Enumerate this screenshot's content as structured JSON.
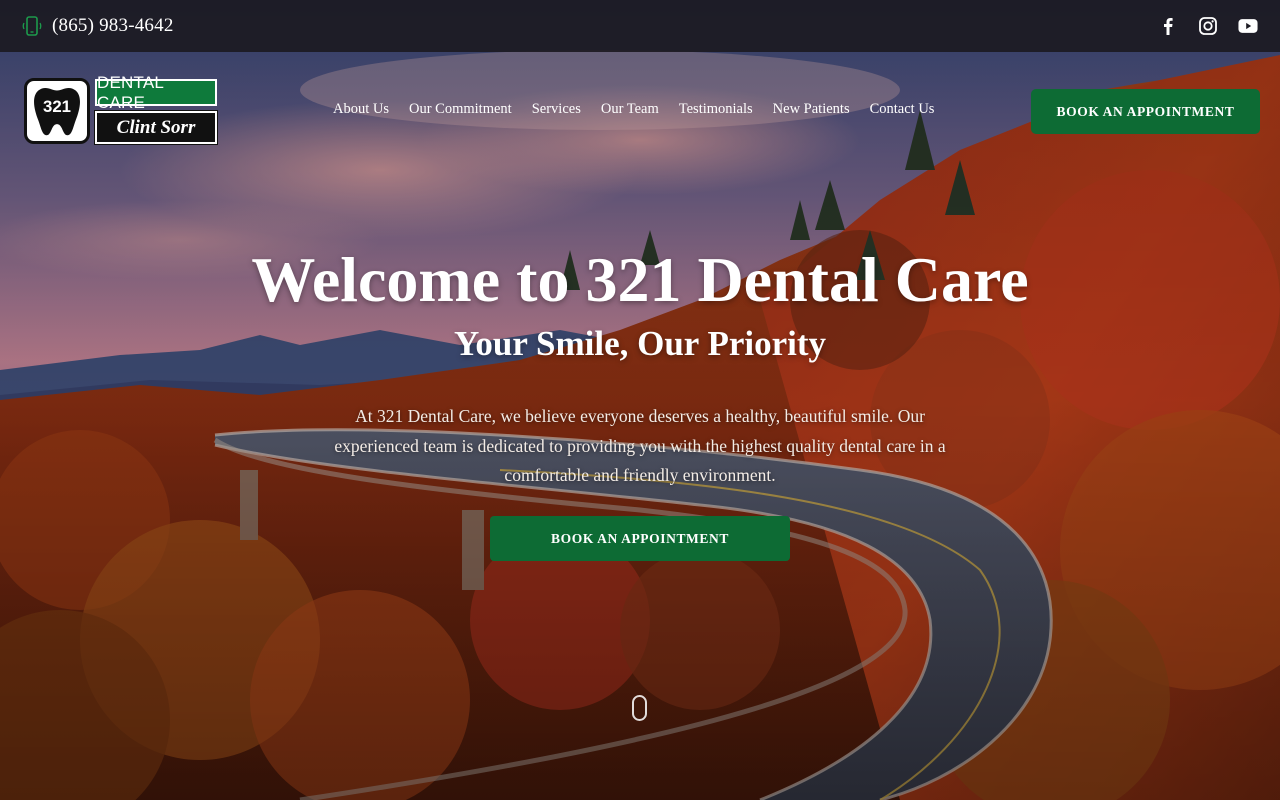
{
  "topbar": {
    "phone_icon": "mobile-phone-icon",
    "phone": "(865) 983-4642",
    "social_icons": [
      "facebook-icon",
      "instagram-icon",
      "youtube-icon"
    ]
  },
  "logo": {
    "number": "321",
    "line1": "DENTAL CARE",
    "line2": "Clint Sorr"
  },
  "nav": {
    "items": [
      "About Us",
      "Our Commitment",
      "Services",
      "Our Team",
      "Testimonials",
      "New Patients",
      "Contact Us"
    ]
  },
  "header_cta": "BOOK AN APPOINTMENT",
  "hero": {
    "title": "Welcome to 321 Dental Care",
    "subtitle": "Your Smile, Our Priority",
    "description": "At 321 Dental Care, we believe everyone deserves a healthy, beautiful smile. Our experienced team is dedicated to providing you with the highest quality dental care in a comfortable and friendly environment.",
    "cta": "BOOK AN APPOINTMENT"
  },
  "colors": {
    "brand_green": "#0d6b34",
    "topbar": "#1c1a22"
  }
}
